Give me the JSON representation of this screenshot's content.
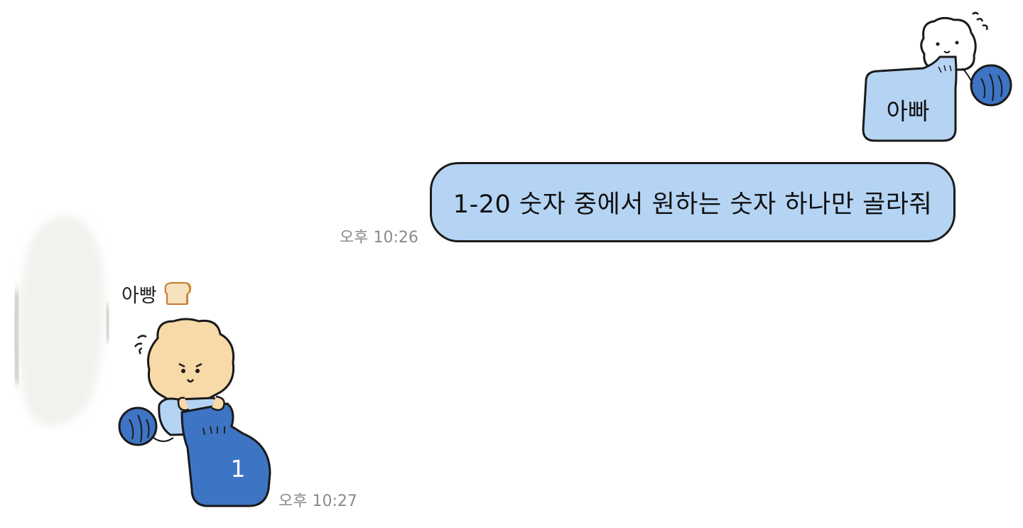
{
  "conversation": {
    "sent": {
      "sticker_text": "아빠",
      "message_text": "1-20 숫자 중에서 원하는 숫자 하나만 골라줘",
      "time": "오후 10:26"
    },
    "received": {
      "sender_name": "아빵",
      "sender_icon": "bread-icon",
      "sticker_text": "1",
      "time": "오후 10:27"
    }
  },
  "colors": {
    "bubble_light_blue": "#b5d4f4",
    "sticker_dark_blue": "#3e74c4",
    "bear_face": "#f8d9a8",
    "timestamp_gray": "#8a8a8a"
  }
}
